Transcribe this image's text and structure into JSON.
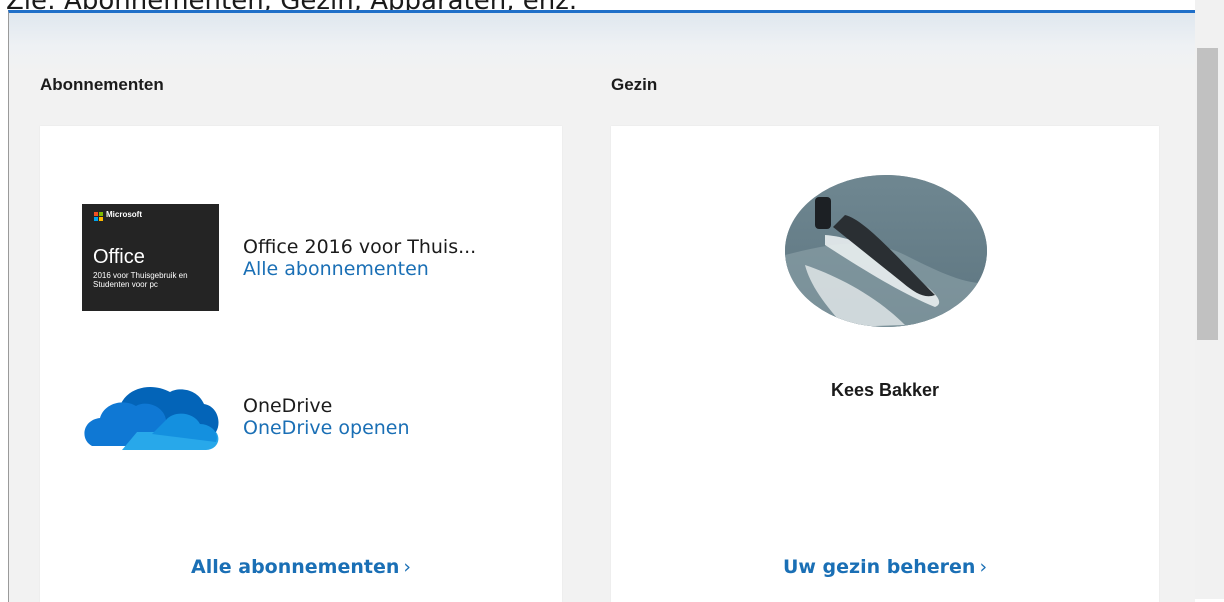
{
  "caption": "Zie: Abonnementen, Gezin, Apparaten, enz.",
  "sections": {
    "subscriptions": {
      "title": "Abonnementen",
      "items": [
        {
          "tile_brand": "Microsoft",
          "tile_title": "Office",
          "tile_subtitle": "2016 voor Thuisgebruik en Studenten voor pc",
          "name": "Office 2016 voor Thuis...",
          "link": "Alle abonnementen",
          "icon": "office-icon"
        },
        {
          "name": "OneDrive",
          "link": "OneDrive openen",
          "icon": "onedrive-cloud-icon"
        }
      ],
      "footer_link": "Alle abonnementen",
      "footer_chevron": "›"
    },
    "family": {
      "title": "Gezin",
      "member_name": "Kees Bakker",
      "avatar": "submarine-photo",
      "footer_link": "Uw gezin beheren",
      "footer_chevron": "›"
    }
  },
  "colors": {
    "accent_link": "#1a6fb5",
    "top_border": "#1f6fc9",
    "page_bg": "#f2f2f2",
    "card_bg": "#ffffff"
  }
}
